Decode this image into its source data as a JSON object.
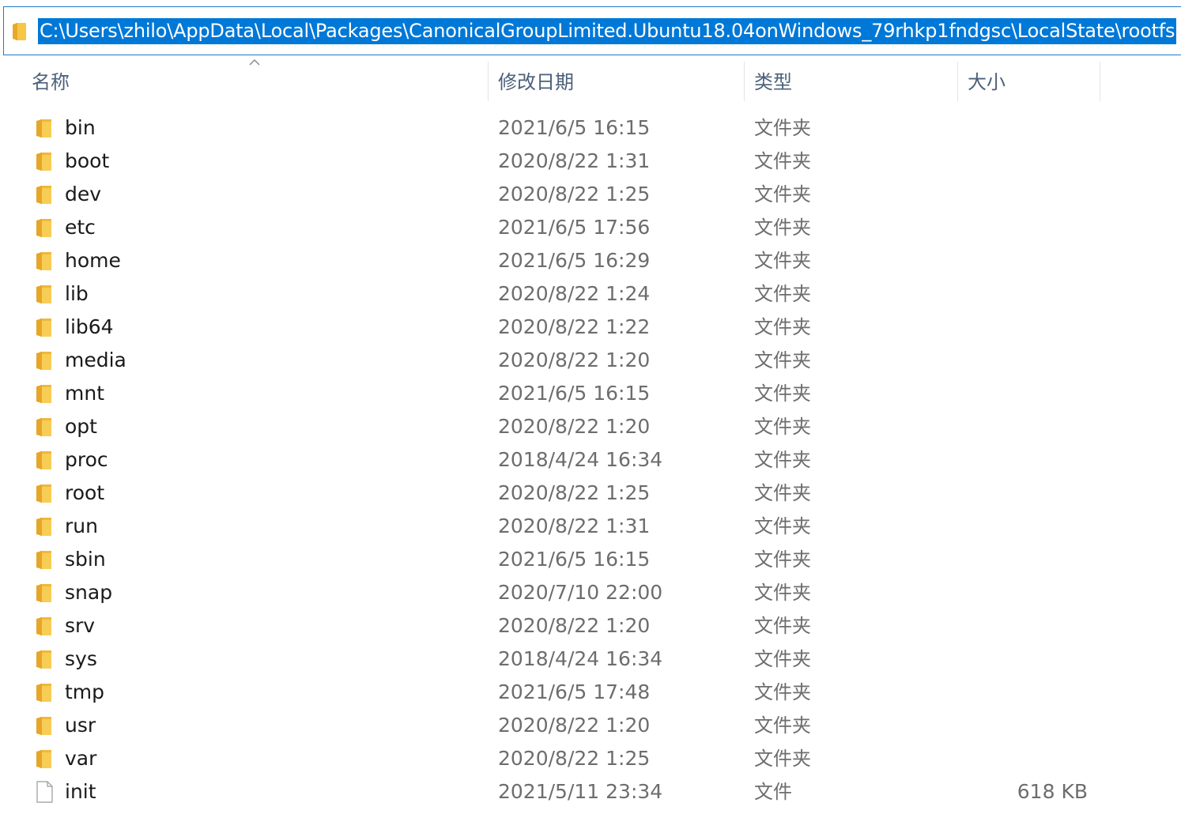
{
  "address_bar": {
    "path": "C:\\Users\\zhilo\\AppData\\Local\\Packages\\CanonicalGroupLimited.Ubuntu18.04onWindows_79rhkp1fndgsc\\LocalState\\rootfs",
    "selection_color": "#0078d7"
  },
  "columns": {
    "name": "名称",
    "modified": "修改日期",
    "type": "类型",
    "size": "大小",
    "sorted_by": "name",
    "sort_direction": "ascending"
  },
  "files": [
    {
      "name": "bin",
      "modified": "2021/6/5 16:15",
      "type": "文件夹",
      "size": "",
      "icon": "folder-icon"
    },
    {
      "name": "boot",
      "modified": "2020/8/22 1:31",
      "type": "文件夹",
      "size": "",
      "icon": "folder-icon"
    },
    {
      "name": "dev",
      "modified": "2020/8/22 1:25",
      "type": "文件夹",
      "size": "",
      "icon": "folder-icon"
    },
    {
      "name": "etc",
      "modified": "2021/6/5 17:56",
      "type": "文件夹",
      "size": "",
      "icon": "folder-icon"
    },
    {
      "name": "home",
      "modified": "2021/6/5 16:29",
      "type": "文件夹",
      "size": "",
      "icon": "folder-icon"
    },
    {
      "name": "lib",
      "modified": "2020/8/22 1:24",
      "type": "文件夹",
      "size": "",
      "icon": "folder-icon"
    },
    {
      "name": "lib64",
      "modified": "2020/8/22 1:22",
      "type": "文件夹",
      "size": "",
      "icon": "folder-icon"
    },
    {
      "name": "media",
      "modified": "2020/8/22 1:20",
      "type": "文件夹",
      "size": "",
      "icon": "folder-icon"
    },
    {
      "name": "mnt",
      "modified": "2021/6/5 16:15",
      "type": "文件夹",
      "size": "",
      "icon": "folder-icon"
    },
    {
      "name": "opt",
      "modified": "2020/8/22 1:20",
      "type": "文件夹",
      "size": "",
      "icon": "folder-icon"
    },
    {
      "name": "proc",
      "modified": "2018/4/24 16:34",
      "type": "文件夹",
      "size": "",
      "icon": "folder-icon"
    },
    {
      "name": "root",
      "modified": "2020/8/22 1:25",
      "type": "文件夹",
      "size": "",
      "icon": "folder-icon"
    },
    {
      "name": "run",
      "modified": "2020/8/22 1:31",
      "type": "文件夹",
      "size": "",
      "icon": "folder-icon"
    },
    {
      "name": "sbin",
      "modified": "2021/6/5 16:15",
      "type": "文件夹",
      "size": "",
      "icon": "folder-icon"
    },
    {
      "name": "snap",
      "modified": "2020/7/10 22:00",
      "type": "文件夹",
      "size": "",
      "icon": "folder-icon"
    },
    {
      "name": "srv",
      "modified": "2020/8/22 1:20",
      "type": "文件夹",
      "size": "",
      "icon": "folder-icon"
    },
    {
      "name": "sys",
      "modified": "2018/4/24 16:34",
      "type": "文件夹",
      "size": "",
      "icon": "folder-icon"
    },
    {
      "name": "tmp",
      "modified": "2021/6/5 17:48",
      "type": "文件夹",
      "size": "",
      "icon": "folder-icon"
    },
    {
      "name": "usr",
      "modified": "2020/8/22 1:20",
      "type": "文件夹",
      "size": "",
      "icon": "folder-icon"
    },
    {
      "name": "var",
      "modified": "2020/8/22 1:25",
      "type": "文件夹",
      "size": "",
      "icon": "folder-icon"
    },
    {
      "name": "init",
      "modified": "2021/5/11 23:34",
      "type": "文件",
      "size": "618 KB",
      "icon": "file-icon"
    }
  ]
}
